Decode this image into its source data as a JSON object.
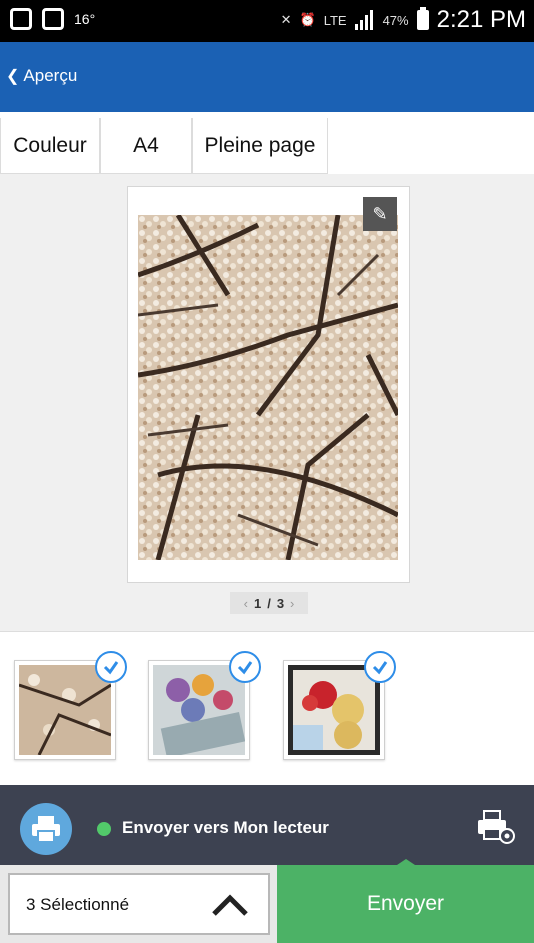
{
  "status_bar": {
    "temperature": "16°",
    "network": "LTE",
    "battery": "47%",
    "time": "2:21 PM"
  },
  "app_bar": {
    "back_label": "Aperçu"
  },
  "options": {
    "color": "Couleur",
    "paper_size": "A4",
    "layout": "Pleine page"
  },
  "preview": {
    "pager_current": "1",
    "pager_separator": "/",
    "pager_total": "3",
    "edit_icon": "pencil-icon"
  },
  "thumbnails": [
    {
      "subject": "cherry-blossoms",
      "checked": true
    },
    {
      "subject": "flower-bouquet",
      "checked": true
    },
    {
      "subject": "teddy-bear-roses",
      "checked": true
    }
  ],
  "send_bar": {
    "target": "Envoyer vers Mon lecteur",
    "status_color": "#52c96a"
  },
  "bottom": {
    "selected_label": "3 Sélectionné",
    "send_label": "Envoyer"
  },
  "colors": {
    "app_bar": "#1b61b4",
    "send_bar": "#3d4251",
    "send_button": "#4cb266",
    "check_accent": "#2e8de8"
  }
}
